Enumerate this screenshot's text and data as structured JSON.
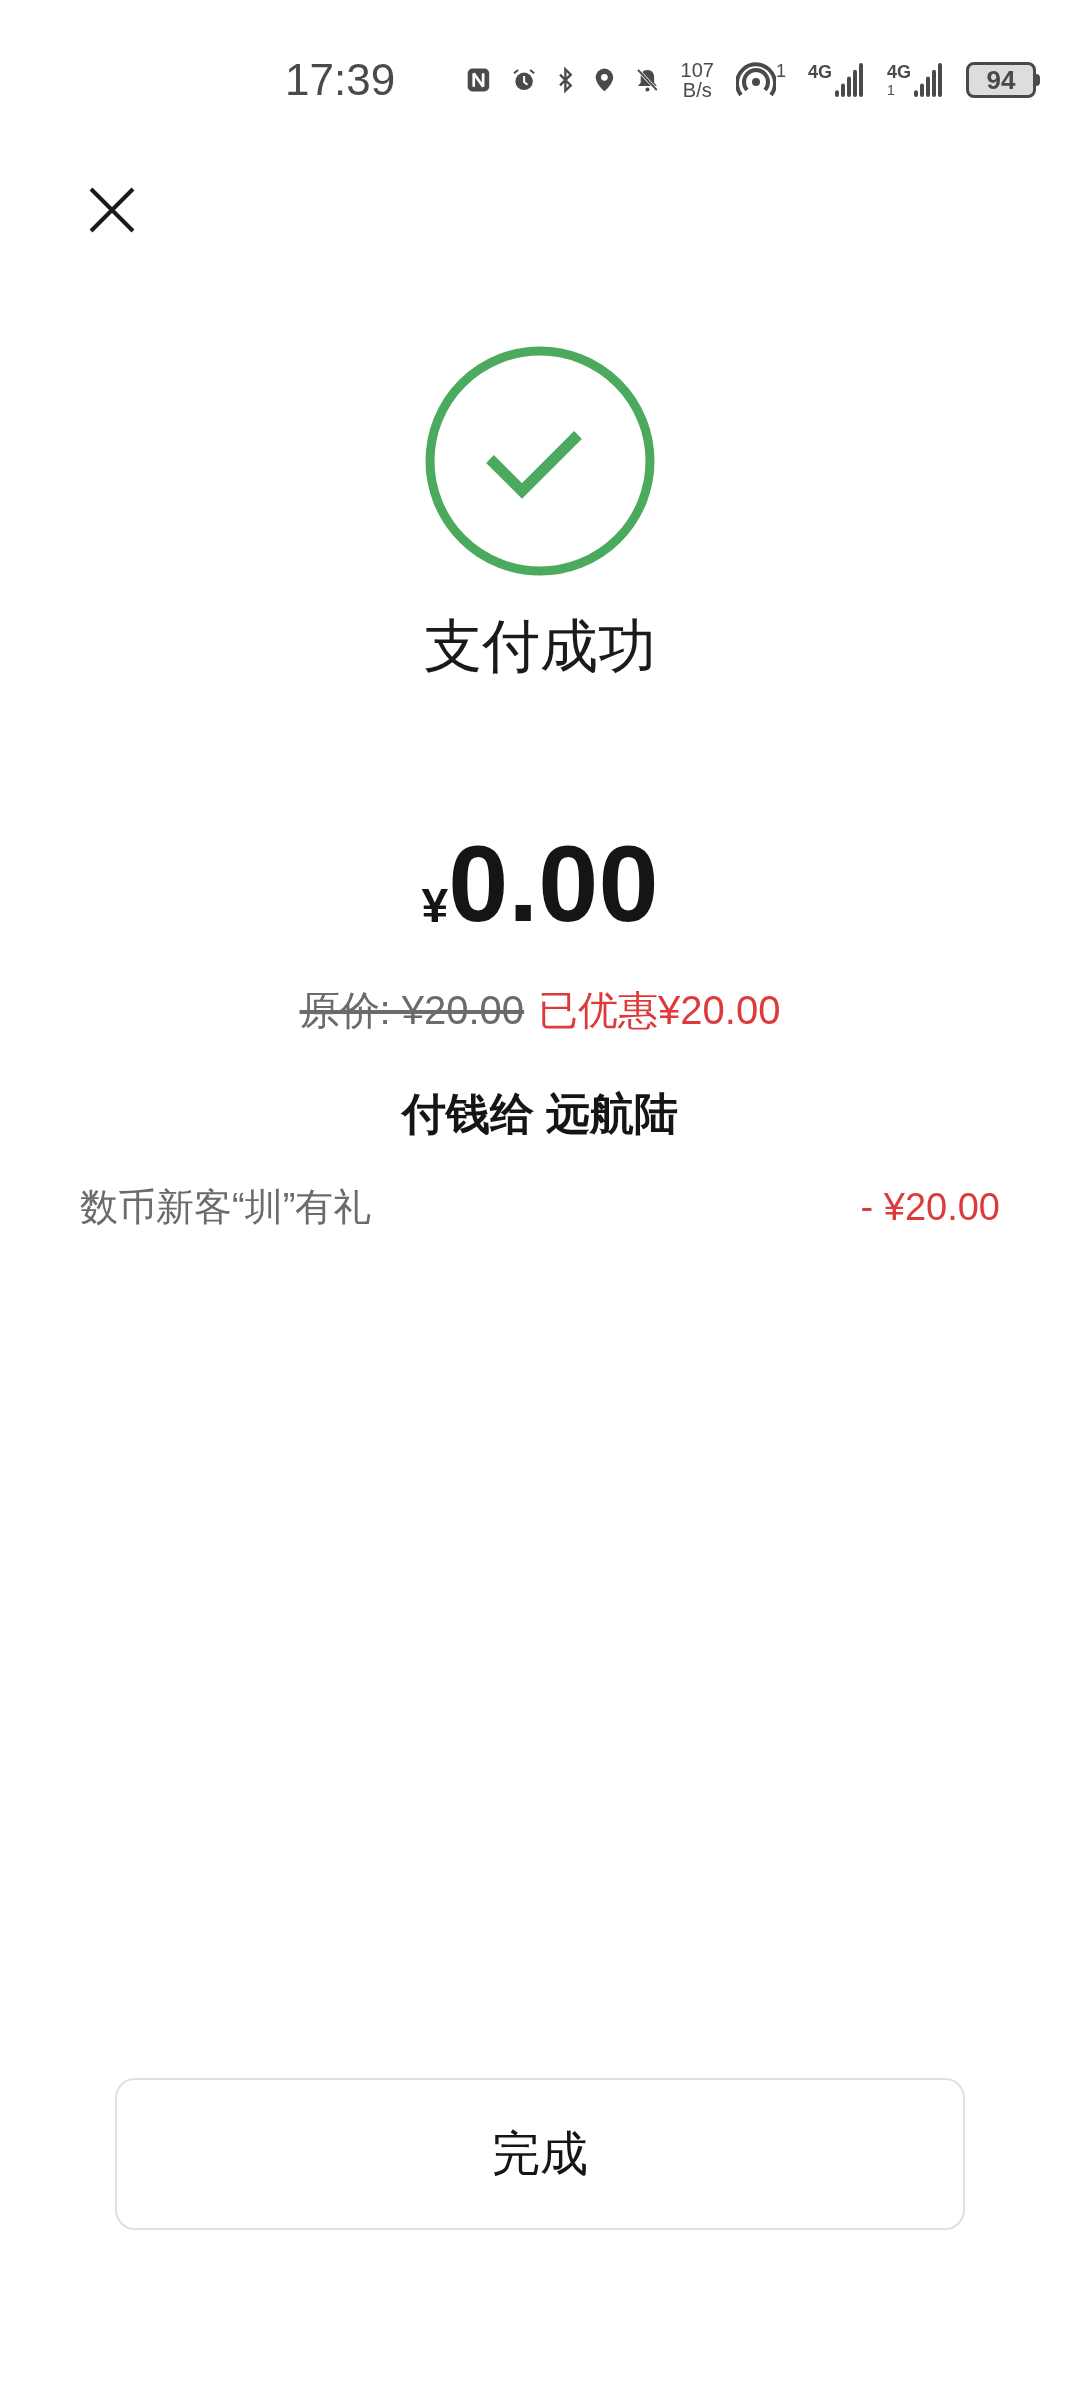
{
  "status_bar": {
    "time": "17:39",
    "speed_value": "107",
    "speed_unit": "B/s",
    "hotspot_count": "1",
    "sim1_network": "4G",
    "sim2_network": "4G",
    "sim2_slot": "1",
    "battery": "94"
  },
  "title": "支付成功",
  "amount": {
    "currency": "¥",
    "value": "0.00"
  },
  "original_price": "原价: ¥20.00",
  "discount_total": "已优惠¥20.00",
  "payee": "付钱给 远航陆",
  "discounts": [
    {
      "label": "数币新客“圳”有礼",
      "amount": "- ¥20.00"
    }
  ],
  "done_button": "完成"
}
